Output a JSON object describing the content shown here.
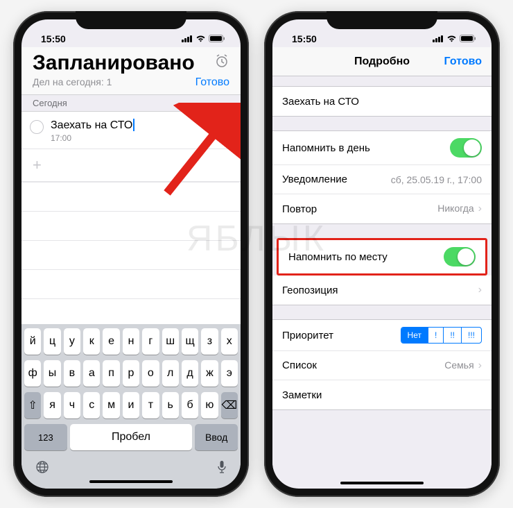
{
  "watermark": "ЯБЛЫК",
  "status": {
    "time": "15:50"
  },
  "left": {
    "title": "Запланировано",
    "subtitle": "Дел на сегодня: 1",
    "done": "Готово",
    "section": "Сегодня",
    "reminder": {
      "title": "Заехать на СТО",
      "time": "17:00"
    },
    "keyboard": {
      "row1": [
        "й",
        "ц",
        "у",
        "к",
        "е",
        "н",
        "г",
        "ш",
        "щ",
        "з",
        "х"
      ],
      "row2": [
        "ф",
        "ы",
        "в",
        "а",
        "п",
        "р",
        "о",
        "л",
        "д",
        "ж",
        "э"
      ],
      "row3_mid": [
        "я",
        "ч",
        "с",
        "м",
        "и",
        "т",
        "ь",
        "б",
        "ю"
      ],
      "shift": "⇧",
      "back": "⌫",
      "numkey": "123",
      "space": "Пробел",
      "return": "Ввод"
    }
  },
  "right": {
    "nav_title": "Подробно",
    "done": "Готово",
    "task_name": "Заехать на СТО",
    "remind_day": "Напомнить в день",
    "notification": "Уведомление",
    "notification_value": "сб, 25.05.19 г., 17:00",
    "repeat": "Повтор",
    "repeat_value": "Никогда",
    "remind_location": "Напомнить по месту",
    "geolocation": "Геопозиция",
    "priority": "Приоритет",
    "priority_options": [
      "Нет",
      "!",
      "!!",
      "!!!"
    ],
    "list": "Список",
    "list_value": "Семья",
    "notes": "Заметки"
  }
}
